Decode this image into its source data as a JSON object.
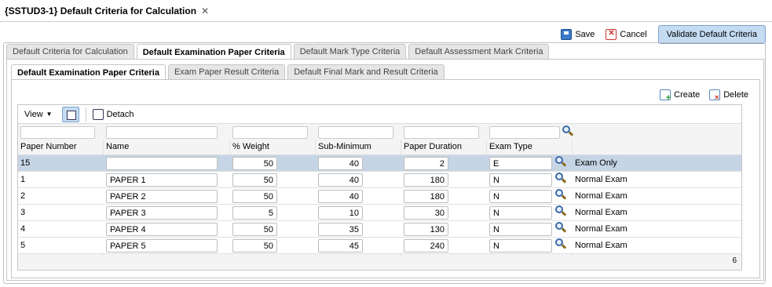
{
  "window": {
    "title": "{SSTUD3-1} Default Criteria for Calculation",
    "close": "✕"
  },
  "topbar": {
    "save": "Save",
    "cancel": "Cancel",
    "validate": "Validate Default Criteria"
  },
  "tabs1": [
    "Default Criteria for Calculation",
    "Default Examination Paper Criteria",
    "Default Mark Type Criteria",
    "Default Assessment Mark Criteria"
  ],
  "tabs2": [
    "Default Examination Paper Criteria",
    "Exam Paper Result Criteria",
    "Default Final Mark and Result Criteria"
  ],
  "actions": {
    "create": "Create",
    "delete": "Delete"
  },
  "toolbar": {
    "view": "View",
    "detach": "Detach"
  },
  "columns": [
    "Paper Number",
    "Name",
    "% Weight",
    "Sub-Minimum",
    "Paper Duration",
    "Exam Type"
  ],
  "rows": [
    {
      "paper": "15",
      "name": "",
      "weight": "50",
      "submin": "40",
      "duration": "2",
      "type": "E",
      "desc": "Exam Only"
    },
    {
      "paper": "1",
      "name": "PAPER 1",
      "weight": "50",
      "submin": "40",
      "duration": "180",
      "type": "N",
      "desc": "Normal Exam"
    },
    {
      "paper": "2",
      "name": "PAPER 2",
      "weight": "50",
      "submin": "40",
      "duration": "180",
      "type": "N",
      "desc": "Normal Exam"
    },
    {
      "paper": "3",
      "name": "PAPER 3",
      "weight": "5",
      "submin": "10",
      "duration": "30",
      "type": "N",
      "desc": "Normal Exam"
    },
    {
      "paper": "4",
      "name": "PAPER 4",
      "weight": "50",
      "submin": "35",
      "duration": "130",
      "type": "N",
      "desc": "Normal Exam"
    },
    {
      "paper": "5",
      "name": "PAPER 5",
      "weight": "50",
      "submin": "45",
      "duration": "240",
      "type": "N",
      "desc": "Normal Exam"
    }
  ],
  "count": "6"
}
